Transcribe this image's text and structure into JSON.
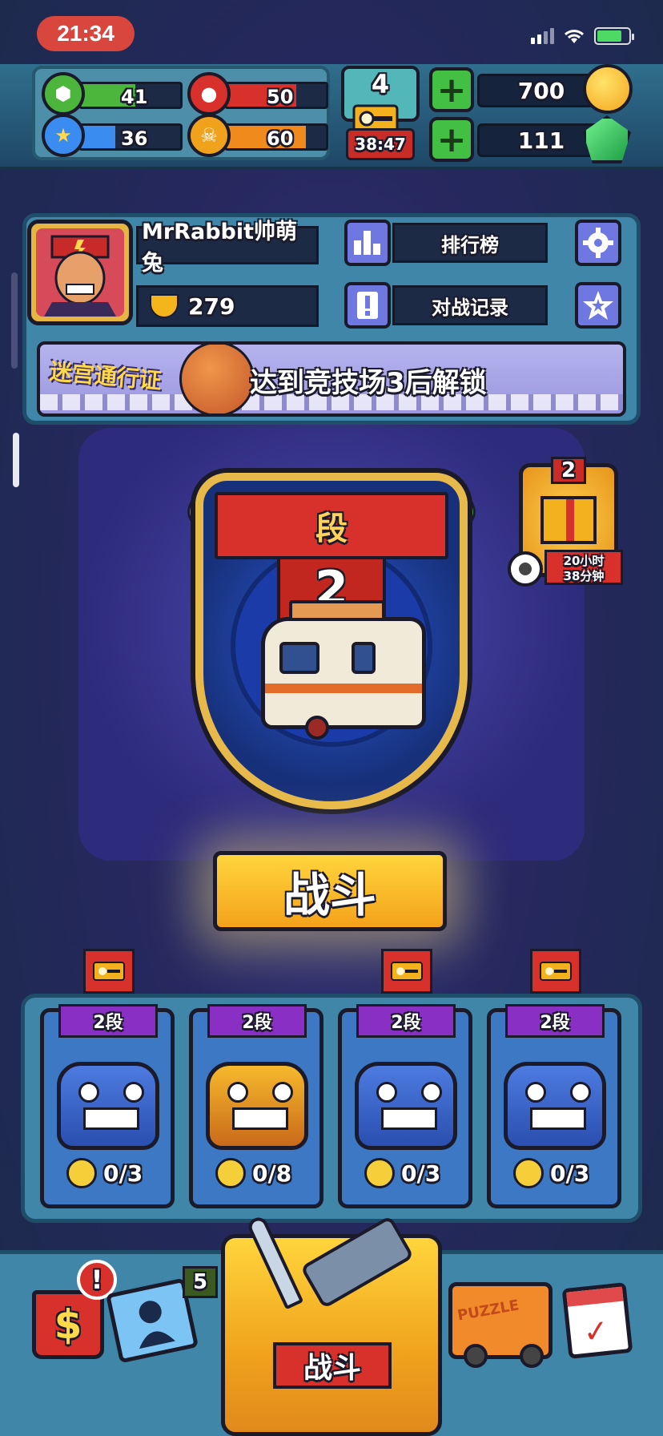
{
  "status_bar": {
    "time": "21:34"
  },
  "hud": {
    "stats": [
      {
        "name": "green-hex",
        "value": "41",
        "fill": 0.55,
        "color": "#4bb53c"
      },
      {
        "name": "red-octagon",
        "value": "50",
        "fill": 0.7,
        "color": "#d8302a"
      },
      {
        "name": "blue-star",
        "value": "36",
        "fill": 0.35,
        "color": "#3a8cf0"
      },
      {
        "name": "gold-skull",
        "value": "60",
        "fill": 0.8,
        "color": "#f08a1c"
      }
    ],
    "keys": {
      "count": "4",
      "timer": "38:47"
    },
    "coins": "700",
    "gems": "111"
  },
  "profile": {
    "username": "MrRabbit帅萌兔",
    "trophies": "279",
    "leaderboard_label": "排行榜",
    "battle_log_label": "对战记录"
  },
  "maze_pass": {
    "label": "迷宫通行证",
    "message": "达到竞技场3后解锁"
  },
  "arena": {
    "tier_label": "段",
    "tier_number": "2",
    "battle_button": "战斗"
  },
  "reward_chest": {
    "level": "2",
    "timer_hours": "20小时",
    "timer_minutes": "38分钟"
  },
  "chest_slots": [
    {
      "tier": "2段",
      "progress": "0/3",
      "type": "blue",
      "has_key": true
    },
    {
      "tier": "2段",
      "progress": "0/8",
      "type": "gold",
      "has_key": false
    },
    {
      "tier": "2段",
      "progress": "0/3",
      "type": "blue",
      "has_key": true
    },
    {
      "tier": "2段",
      "progress": "0/3",
      "type": "blue",
      "has_key": true
    }
  ],
  "bottom_nav": {
    "shop_alert": "!",
    "cards_badge": "5",
    "battle_label": "战斗",
    "truck_text": "PUZZLE"
  },
  "colors": {
    "accent_gold": "#ffd53c",
    "banner_red": "#d8302a",
    "panel_blue": "#3f86a8"
  }
}
